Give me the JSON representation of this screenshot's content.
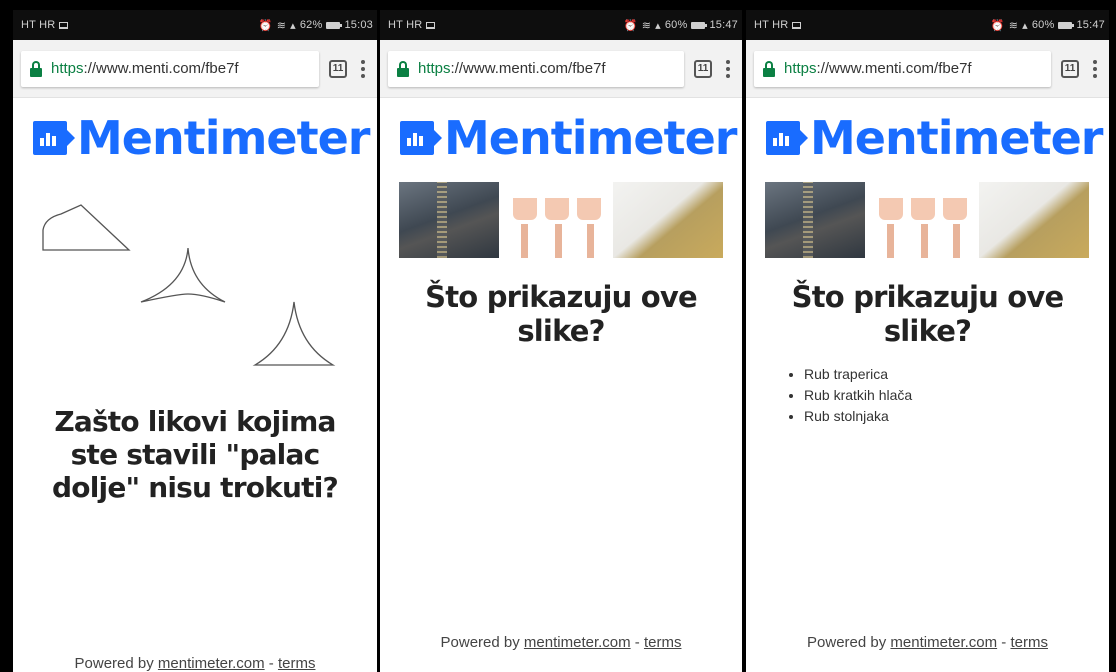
{
  "screens": [
    {
      "status": {
        "carrier": "HT HR",
        "battery": "62%",
        "time": "15:03"
      },
      "url": {
        "scheme": "https",
        "rest": "://www.menti.com/fbe7f",
        "tab_count": "11"
      },
      "logo_text": "Mentimeter",
      "question": "Zašto likovi kojima ste stavili \"palac dolje\" nisu trokuti?",
      "footer": {
        "prefix": "Powered by ",
        "link": "mentimeter.com",
        "sep": " - ",
        "terms": "terms"
      }
    },
    {
      "status": {
        "carrier": "HT HR",
        "battery": "60%",
        "time": "15:47"
      },
      "url": {
        "scheme": "https",
        "rest": "://www.menti.com/fbe7f",
        "tab_count": "11"
      },
      "logo_text": "Mentimeter",
      "question": "Što prikazuju ove slike?",
      "footer": {
        "prefix": "Powered by ",
        "link": "mentimeter.com",
        "sep": " - ",
        "terms": "terms"
      }
    },
    {
      "status": {
        "carrier": "HT HR",
        "battery": "60%",
        "time": "15:47"
      },
      "url": {
        "scheme": "https",
        "rest": "://www.menti.com/fbe7f",
        "tab_count": "11"
      },
      "logo_text": "Mentimeter",
      "question": "Što prikazuju ove slike?",
      "answers": [
        "Rub traperica",
        "Rub kratkih hlača",
        "Rub stolnjaka"
      ],
      "footer": {
        "prefix": "Powered by ",
        "link": "mentimeter.com",
        "sep": " - ",
        "terms": "terms"
      }
    }
  ],
  "colors": {
    "brand_blue": "#196cff",
    "lock_green": "#0b8043",
    "status_bar": "#0e0e0e"
  }
}
